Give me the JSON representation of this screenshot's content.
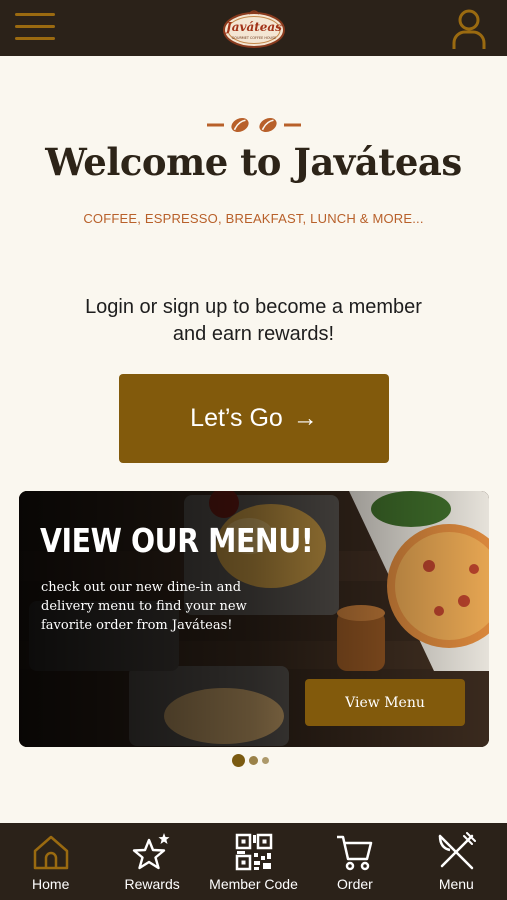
{
  "header": {
    "logo_text": "Javáteas",
    "logo_tagline": "GOURMET COFFEE HOUSE",
    "menu_icon": "hamburger-icon",
    "profile_icon": "user-icon"
  },
  "hero": {
    "title": "Welcome to Javáteas",
    "subtitle": "COFFEE, ESPRESSO, BREAKFAST, LUNCH & MORE...",
    "prompt_line1": "Login or sign up to become a member",
    "prompt_line2": "and earn rewards!",
    "cta_label": "Let’s Go",
    "cta_arrow": "→"
  },
  "banner": {
    "title": "VIEW OUR MENU!",
    "text": "check out our new dine-in and delivery menu to find your new favorite order from Javáteas!",
    "button_label": "View Menu"
  },
  "carousel": {
    "slides": 3,
    "active": 1
  },
  "tabs": [
    {
      "label": "Home",
      "icon": "home-icon",
      "active": true
    },
    {
      "label": "Rewards",
      "icon": "star-icon",
      "active": false
    },
    {
      "label": "Member Code",
      "icon": "qr-code-icon",
      "active": false
    },
    {
      "label": "Order",
      "icon": "cart-icon",
      "active": false
    },
    {
      "label": "Menu",
      "icon": "utensils-icon",
      "active": false
    }
  ],
  "colors": {
    "bar": "#2b2219",
    "accent": "#825a0c",
    "active_icon": "#9a6a10",
    "background": "#faf7ef",
    "subtitle": "#b8602a"
  }
}
